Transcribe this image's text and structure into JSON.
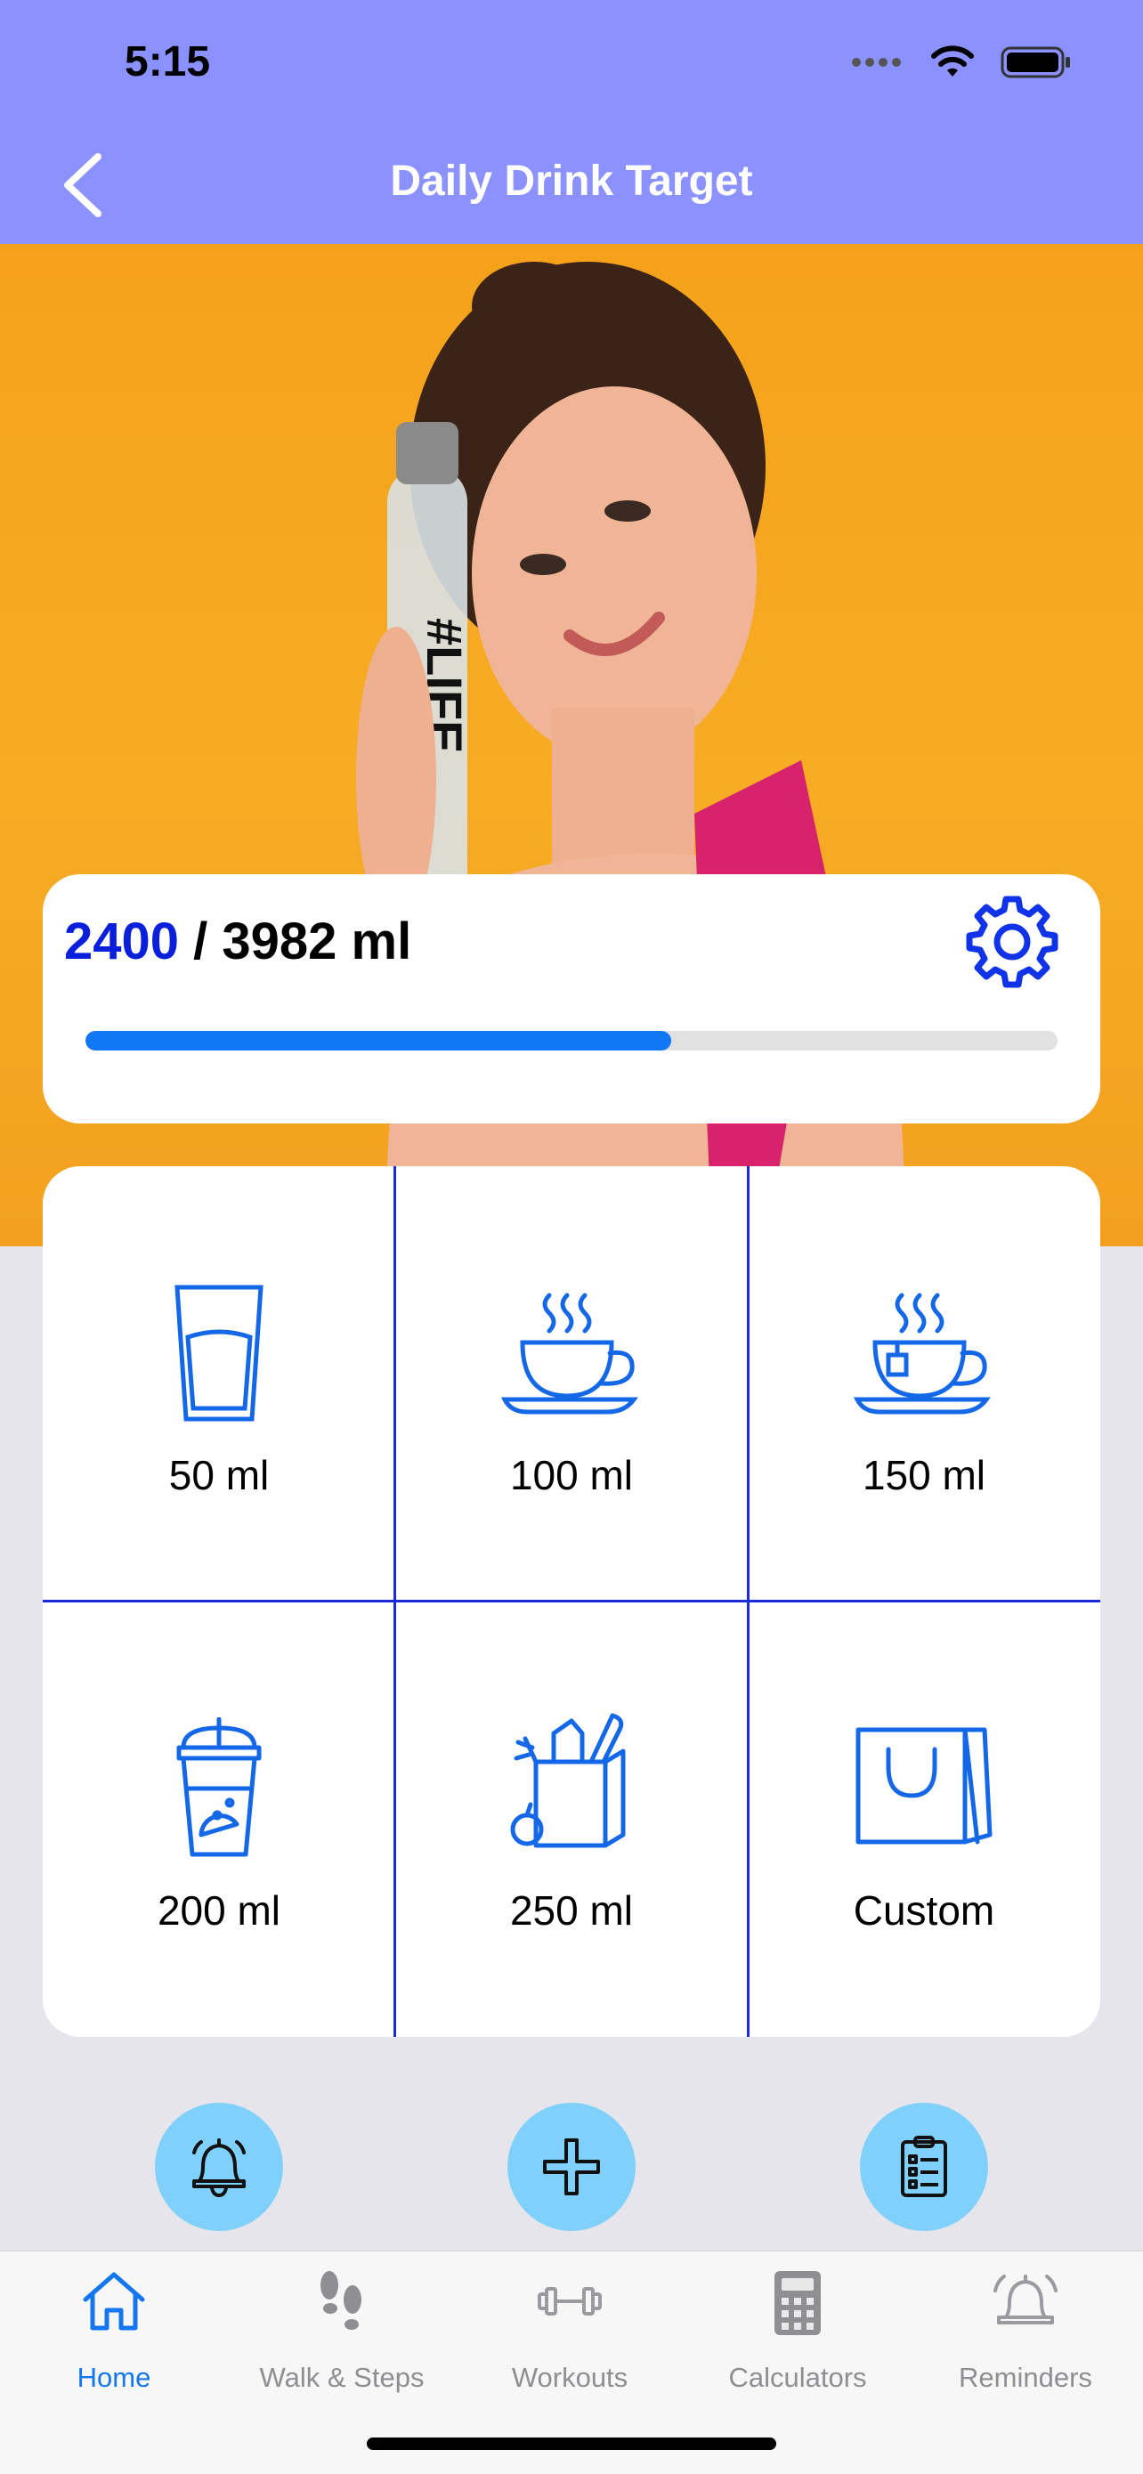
{
  "status": {
    "time": "5:15"
  },
  "nav": {
    "title": "Daily Drink Target"
  },
  "progress": {
    "current": "2400",
    "separator": " / ",
    "target": "3982 ml",
    "fraction": 0.603
  },
  "drinks": [
    {
      "label": "50 ml",
      "icon": "glass-icon"
    },
    {
      "label": "100 ml",
      "icon": "coffee-cup-icon"
    },
    {
      "label": "150 ml",
      "icon": "tea-cup-icon"
    },
    {
      "label": "200 ml",
      "icon": "smoothie-cup-icon"
    },
    {
      "label": "250 ml",
      "icon": "grocery-bag-icon"
    },
    {
      "label": "Custom",
      "icon": "shopping-bag-icon"
    }
  ],
  "actions": [
    {
      "icon": "bell-icon"
    },
    {
      "icon": "plus-icon"
    },
    {
      "icon": "clipboard-icon"
    }
  ],
  "tabs": [
    {
      "label": "Home",
      "icon": "home-icon",
      "active": true
    },
    {
      "label": "Walk & Steps",
      "icon": "footprints-icon",
      "active": false
    },
    {
      "label": "Workouts",
      "icon": "dumbbell-icon",
      "active": false
    },
    {
      "label": "Calculators",
      "icon": "calculator-icon",
      "active": false
    },
    {
      "label": "Reminders",
      "icon": "alarm-icon",
      "active": false
    }
  ],
  "colors": {
    "header": "#8b92ff",
    "accent": "#1277f5",
    "current_value": "#0a1fdc",
    "grid_lines": "#1a2ad8",
    "action_button": "#7fd1fb",
    "hero_background": "#f5a21a"
  }
}
